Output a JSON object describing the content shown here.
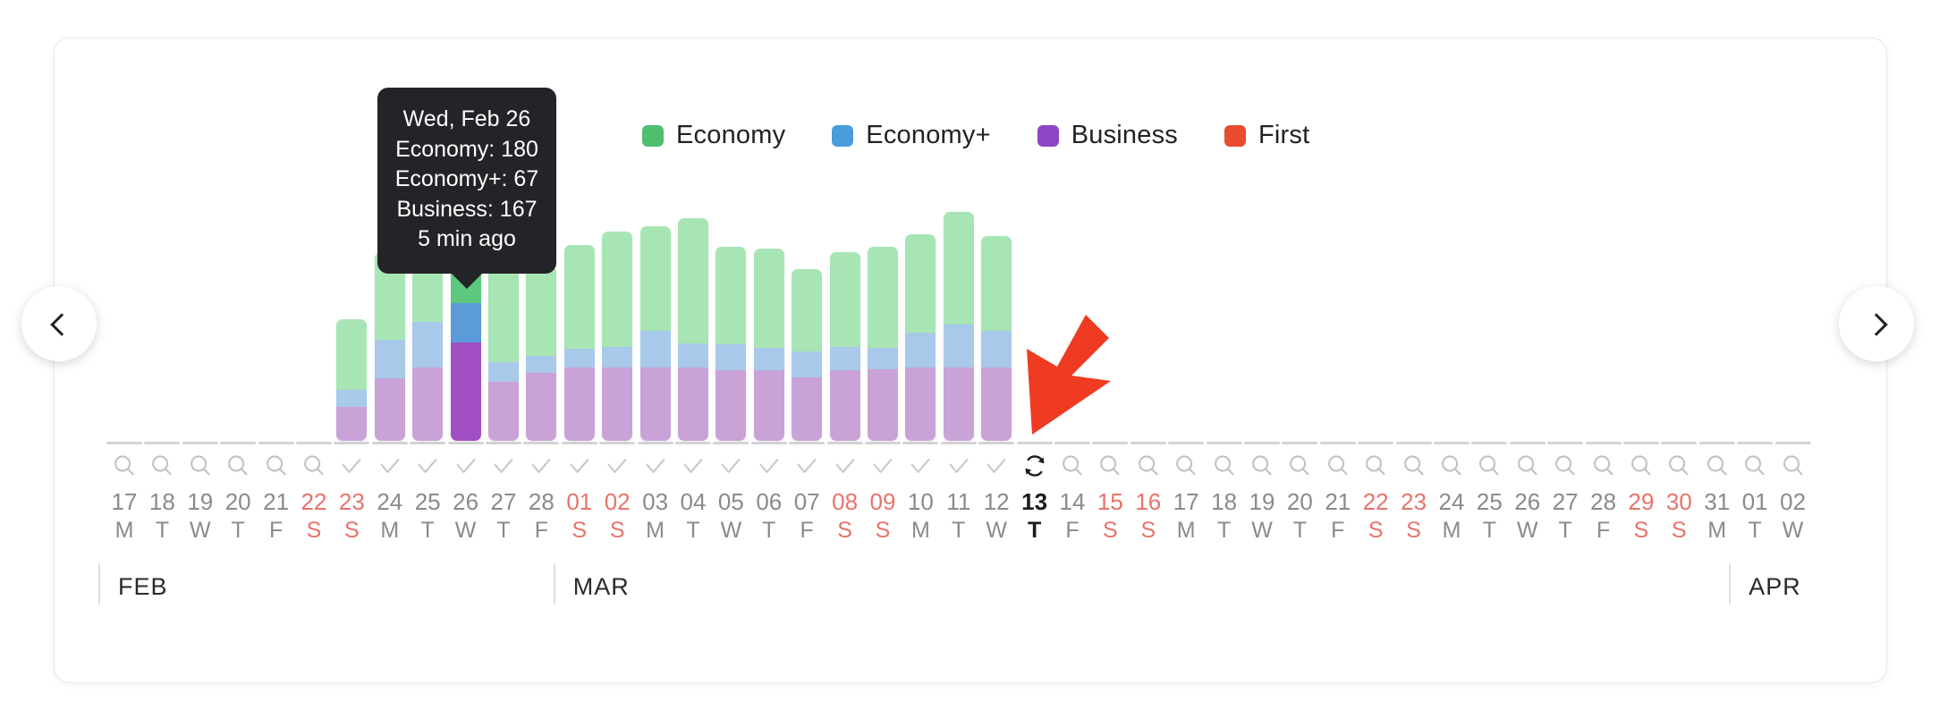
{
  "nav": {
    "prev_label": "‹",
    "prev_icon": "chevron-left-icon",
    "next_label": "›",
    "next_icon": "chevron-right-icon"
  },
  "legend": {
    "items": [
      {
        "label": "Economy",
        "color": "#4FBE6E"
      },
      {
        "label": "Economy+",
        "color": "#4A9DDC"
      },
      {
        "label": "Business",
        "color": "#8E44C7"
      },
      {
        "label": "First",
        "color": "#E84C31"
      }
    ]
  },
  "tooltip": {
    "visible": true,
    "date": "Wed, Feb 26",
    "economy": "Economy: 180",
    "economy_plus": "Economy+: 67",
    "business": "Business: 167",
    "updated": "5 min ago",
    "background": "#222427"
  },
  "months": [
    {
      "label": "FEB",
      "start_index": 0
    },
    {
      "label": "MAR",
      "start_index": 12
    },
    {
      "label": "APR",
      "start_index": 43
    }
  ],
  "chart_data": {
    "type": "bar",
    "stacked": true,
    "title": "",
    "xlabel": "",
    "ylabel": "",
    "ylim": [
      0,
      460
    ],
    "grid": false,
    "legend_position": "top-center",
    "series": [
      {
        "name": "Economy",
        "color": "#4FBE6E"
      },
      {
        "name": "Economy+",
        "color": "#4A9DDC"
      },
      {
        "name": "Business",
        "color": "#8E44C7"
      },
      {
        "name": "First",
        "color": "#E84C31"
      }
    ],
    "categories": [
      "17 M",
      "18 T",
      "19 W",
      "20 T",
      "21 F",
      "22 S",
      "23 S",
      "24 M",
      "25 T",
      "26 W",
      "27 T",
      "28 F",
      "01 S",
      "02 S",
      "03 M",
      "04 T",
      "05 W",
      "06 T",
      "07 F",
      "08 S",
      "09 S",
      "10 M",
      "11 T",
      "12 W",
      "13 T",
      "14 F",
      "15 S",
      "16 S",
      "17 M",
      "18 T",
      "19 W",
      "20 T",
      "21 F",
      "22 S",
      "23 S",
      "24 M",
      "25 T",
      "26 W",
      "27 T",
      "28 F",
      "29 S",
      "30 S",
      "31 M",
      "01 T",
      "02 W"
    ],
    "points": [
      {
        "date": "17 M",
        "dow": "M",
        "num": "17",
        "month": "FEB",
        "weekend": false,
        "today": false,
        "icon": "magnifier-icon",
        "economy": 0,
        "economy_plus": 0,
        "business": 0,
        "first": 0
      },
      {
        "date": "18 T",
        "dow": "T",
        "num": "18",
        "month": "FEB",
        "weekend": false,
        "today": false,
        "icon": "magnifier-icon",
        "economy": 0,
        "economy_plus": 0,
        "business": 0,
        "first": 0
      },
      {
        "date": "19 W",
        "dow": "W",
        "num": "19",
        "month": "FEB",
        "weekend": false,
        "today": false,
        "icon": "magnifier-icon",
        "economy": 0,
        "economy_plus": 0,
        "business": 0,
        "first": 0
      },
      {
        "date": "20 T",
        "dow": "T",
        "num": "20",
        "month": "FEB",
        "weekend": false,
        "today": false,
        "icon": "magnifier-icon",
        "economy": 0,
        "economy_plus": 0,
        "business": 0,
        "first": 0
      },
      {
        "date": "21 F",
        "dow": "F",
        "num": "21",
        "month": "FEB",
        "weekend": false,
        "today": false,
        "icon": "magnifier-icon",
        "economy": 0,
        "economy_plus": 0,
        "business": 0,
        "first": 0
      },
      {
        "date": "22 S",
        "dow": "S",
        "num": "22",
        "month": "FEB",
        "weekend": true,
        "today": false,
        "icon": "magnifier-icon",
        "economy": 0,
        "economy_plus": 0,
        "business": 0,
        "first": 0
      },
      {
        "date": "23 S",
        "dow": "S",
        "num": "23",
        "month": "FEB",
        "weekend": true,
        "today": false,
        "icon": "check-icon",
        "economy": 120,
        "economy_plus": 28,
        "business": 58,
        "first": 0
      },
      {
        "date": "24 M",
        "dow": "M",
        "num": "24",
        "month": "FEB",
        "weekend": false,
        "today": false,
        "icon": "check-icon",
        "economy": 148,
        "economy_plus": 66,
        "business": 106,
        "first": 0
      },
      {
        "date": "25 T",
        "dow": "T",
        "num": "25",
        "month": "FEB",
        "weekend": false,
        "today": false,
        "icon": "check-icon",
        "economy": 150,
        "economy_plus": 78,
        "business": 124,
        "first": 0
      },
      {
        "date": "26 W",
        "dow": "W",
        "num": "26",
        "month": "FEB",
        "weekend": false,
        "today": false,
        "icon": "check-icon",
        "economy": 180,
        "economy_plus": 67,
        "business": 167,
        "first": 0,
        "highlighted": true
      },
      {
        "date": "27 T",
        "dow": "T",
        "num": "27",
        "month": "FEB",
        "weekend": false,
        "today": false,
        "icon": "check-icon",
        "economy": 178,
        "economy_plus": 34,
        "business": 100,
        "first": 0
      },
      {
        "date": "28 F",
        "dow": "F",
        "num": "28",
        "month": "FEB",
        "weekend": false,
        "today": false,
        "icon": "check-icon",
        "economy": 152,
        "economy_plus": 28,
        "business": 116,
        "first": 0
      },
      {
        "date": "01 S",
        "dow": "S",
        "num": "01",
        "month": "MAR",
        "weekend": true,
        "today": false,
        "icon": "check-icon",
        "economy": 176,
        "economy_plus": 32,
        "business": 124,
        "first": 0
      },
      {
        "date": "02 S",
        "dow": "S",
        "num": "02",
        "month": "MAR",
        "weekend": true,
        "today": false,
        "icon": "check-icon",
        "economy": 196,
        "economy_plus": 36,
        "business": 124,
        "first": 0
      },
      {
        "date": "03 M",
        "dow": "M",
        "num": "03",
        "month": "MAR",
        "weekend": false,
        "today": false,
        "icon": "check-icon",
        "economy": 178,
        "economy_plus": 62,
        "business": 124,
        "first": 0
      },
      {
        "date": "04 T",
        "dow": "T",
        "num": "04",
        "month": "MAR",
        "weekend": false,
        "today": false,
        "icon": "check-icon",
        "economy": 212,
        "economy_plus": 42,
        "business": 124,
        "first": 0
      },
      {
        "date": "05 W",
        "dow": "W",
        "num": "05",
        "month": "MAR",
        "weekend": false,
        "today": false,
        "icon": "check-icon",
        "economy": 166,
        "economy_plus": 44,
        "business": 120,
        "first": 0
      },
      {
        "date": "06 T",
        "dow": "T",
        "num": "06",
        "month": "MAR",
        "weekend": false,
        "today": false,
        "icon": "check-icon",
        "economy": 168,
        "economy_plus": 38,
        "business": 120,
        "first": 0
      },
      {
        "date": "07 F",
        "dow": "F",
        "num": "07",
        "month": "MAR",
        "weekend": false,
        "today": false,
        "icon": "check-icon",
        "economy": 140,
        "economy_plus": 44,
        "business": 108,
        "first": 0
      },
      {
        "date": "08 S",
        "dow": "S",
        "num": "08",
        "month": "MAR",
        "weekend": true,
        "today": false,
        "icon": "check-icon",
        "economy": 160,
        "economy_plus": 40,
        "business": 120,
        "first": 0
      },
      {
        "date": "09 S",
        "dow": "S",
        "num": "09",
        "month": "MAR",
        "weekend": true,
        "today": false,
        "icon": "check-icon",
        "economy": 172,
        "economy_plus": 36,
        "business": 122,
        "first": 0
      },
      {
        "date": "10 M",
        "dow": "M",
        "num": "10",
        "month": "MAR",
        "weekend": false,
        "today": false,
        "icon": "check-icon",
        "economy": 166,
        "economy_plus": 60,
        "business": 124,
        "first": 0
      },
      {
        "date": "11 T",
        "dow": "T",
        "num": "11",
        "month": "MAR",
        "weekend": false,
        "today": false,
        "icon": "check-icon",
        "economy": 190,
        "economy_plus": 74,
        "business": 124,
        "first": 0
      },
      {
        "date": "12 W",
        "dow": "W",
        "num": "12",
        "month": "MAR",
        "weekend": false,
        "today": false,
        "icon": "check-icon",
        "economy": 162,
        "economy_plus": 62,
        "business": 124,
        "first": 0
      },
      {
        "date": "13 T",
        "dow": "T",
        "num": "13",
        "month": "MAR",
        "weekend": false,
        "today": true,
        "icon": "refresh-icon",
        "economy": 0,
        "economy_plus": 0,
        "business": 0,
        "first": 0
      },
      {
        "date": "14 F",
        "dow": "F",
        "num": "14",
        "month": "MAR",
        "weekend": false,
        "today": false,
        "icon": "magnifier-icon",
        "economy": 0,
        "economy_plus": 0,
        "business": 0,
        "first": 0
      },
      {
        "date": "15 S",
        "dow": "S",
        "num": "15",
        "month": "MAR",
        "weekend": true,
        "today": false,
        "icon": "magnifier-icon",
        "economy": 0,
        "economy_plus": 0,
        "business": 0,
        "first": 0
      },
      {
        "date": "16 S",
        "dow": "S",
        "num": "16",
        "month": "MAR",
        "weekend": true,
        "today": false,
        "icon": "magnifier-icon",
        "economy": 0,
        "economy_plus": 0,
        "business": 0,
        "first": 0
      },
      {
        "date": "17 M",
        "dow": "M",
        "num": "17",
        "month": "MAR",
        "weekend": false,
        "today": false,
        "icon": "magnifier-icon",
        "economy": 0,
        "economy_plus": 0,
        "business": 0,
        "first": 0
      },
      {
        "date": "18 T",
        "dow": "T",
        "num": "18",
        "month": "MAR",
        "weekend": false,
        "today": false,
        "icon": "magnifier-icon",
        "economy": 0,
        "economy_plus": 0,
        "business": 0,
        "first": 0
      },
      {
        "date": "19 W",
        "dow": "W",
        "num": "19",
        "month": "MAR",
        "weekend": false,
        "today": false,
        "icon": "magnifier-icon",
        "economy": 0,
        "economy_plus": 0,
        "business": 0,
        "first": 0
      },
      {
        "date": "20 T",
        "dow": "T",
        "num": "20",
        "month": "MAR",
        "weekend": false,
        "today": false,
        "icon": "magnifier-icon",
        "economy": 0,
        "economy_plus": 0,
        "business": 0,
        "first": 0
      },
      {
        "date": "21 F",
        "dow": "F",
        "num": "21",
        "month": "MAR",
        "weekend": false,
        "today": false,
        "icon": "magnifier-icon",
        "economy": 0,
        "economy_plus": 0,
        "business": 0,
        "first": 0
      },
      {
        "date": "22 S",
        "dow": "S",
        "num": "22",
        "month": "MAR",
        "weekend": true,
        "today": false,
        "icon": "magnifier-icon",
        "economy": 0,
        "economy_plus": 0,
        "business": 0,
        "first": 0
      },
      {
        "date": "23 S",
        "dow": "S",
        "num": "23",
        "month": "MAR",
        "weekend": true,
        "today": false,
        "icon": "magnifier-icon",
        "economy": 0,
        "economy_plus": 0,
        "business": 0,
        "first": 0
      },
      {
        "date": "24 M",
        "dow": "M",
        "num": "24",
        "month": "MAR",
        "weekend": false,
        "today": false,
        "icon": "magnifier-icon",
        "economy": 0,
        "economy_plus": 0,
        "business": 0,
        "first": 0
      },
      {
        "date": "25 T",
        "dow": "T",
        "num": "25",
        "month": "MAR",
        "weekend": false,
        "today": false,
        "icon": "magnifier-icon",
        "economy": 0,
        "economy_plus": 0,
        "business": 0,
        "first": 0
      },
      {
        "date": "26 W",
        "dow": "W",
        "num": "26",
        "month": "MAR",
        "weekend": false,
        "today": false,
        "icon": "magnifier-icon",
        "economy": 0,
        "economy_plus": 0,
        "business": 0,
        "first": 0
      },
      {
        "date": "27 T",
        "dow": "T",
        "num": "27",
        "month": "MAR",
        "weekend": false,
        "today": false,
        "icon": "magnifier-icon",
        "economy": 0,
        "economy_plus": 0,
        "business": 0,
        "first": 0
      },
      {
        "date": "28 F",
        "dow": "F",
        "num": "28",
        "month": "MAR",
        "weekend": false,
        "today": false,
        "icon": "magnifier-icon",
        "economy": 0,
        "economy_plus": 0,
        "business": 0,
        "first": 0
      },
      {
        "date": "29 S",
        "dow": "S",
        "num": "29",
        "month": "MAR",
        "weekend": true,
        "today": false,
        "icon": "magnifier-icon",
        "economy": 0,
        "economy_plus": 0,
        "business": 0,
        "first": 0
      },
      {
        "date": "30 S",
        "dow": "S",
        "num": "30",
        "month": "MAR",
        "weekend": true,
        "today": false,
        "icon": "magnifier-icon",
        "economy": 0,
        "economy_plus": 0,
        "business": 0,
        "first": 0
      },
      {
        "date": "31 M",
        "dow": "M",
        "num": "31",
        "month": "MAR",
        "weekend": false,
        "today": false,
        "icon": "magnifier-icon",
        "economy": 0,
        "economy_plus": 0,
        "business": 0,
        "first": 0
      },
      {
        "date": "01 T",
        "dow": "T",
        "num": "01",
        "month": "APR",
        "weekend": false,
        "today": false,
        "icon": "magnifier-icon",
        "economy": 0,
        "economy_plus": 0,
        "business": 0,
        "first": 0
      },
      {
        "date": "02 W",
        "dow": "W",
        "num": "02",
        "month": "APR",
        "weekend": false,
        "today": false,
        "icon": "magnifier-icon",
        "economy": 0,
        "economy_plus": 0,
        "business": 0,
        "first": 0
      }
    ]
  },
  "annotation": {
    "pointer_icon": "red-arrow-cursor",
    "color": "#EE3B22"
  },
  "theme": {
    "weekend_text": "#e8736a",
    "normal_text": "#8a8a8a",
    "today_text": "#1b1b1b",
    "faded_economy": "#a8e5b4",
    "faded_economy_plus": "#a9c9ea",
    "faded_business": "#c9a2d8"
  }
}
